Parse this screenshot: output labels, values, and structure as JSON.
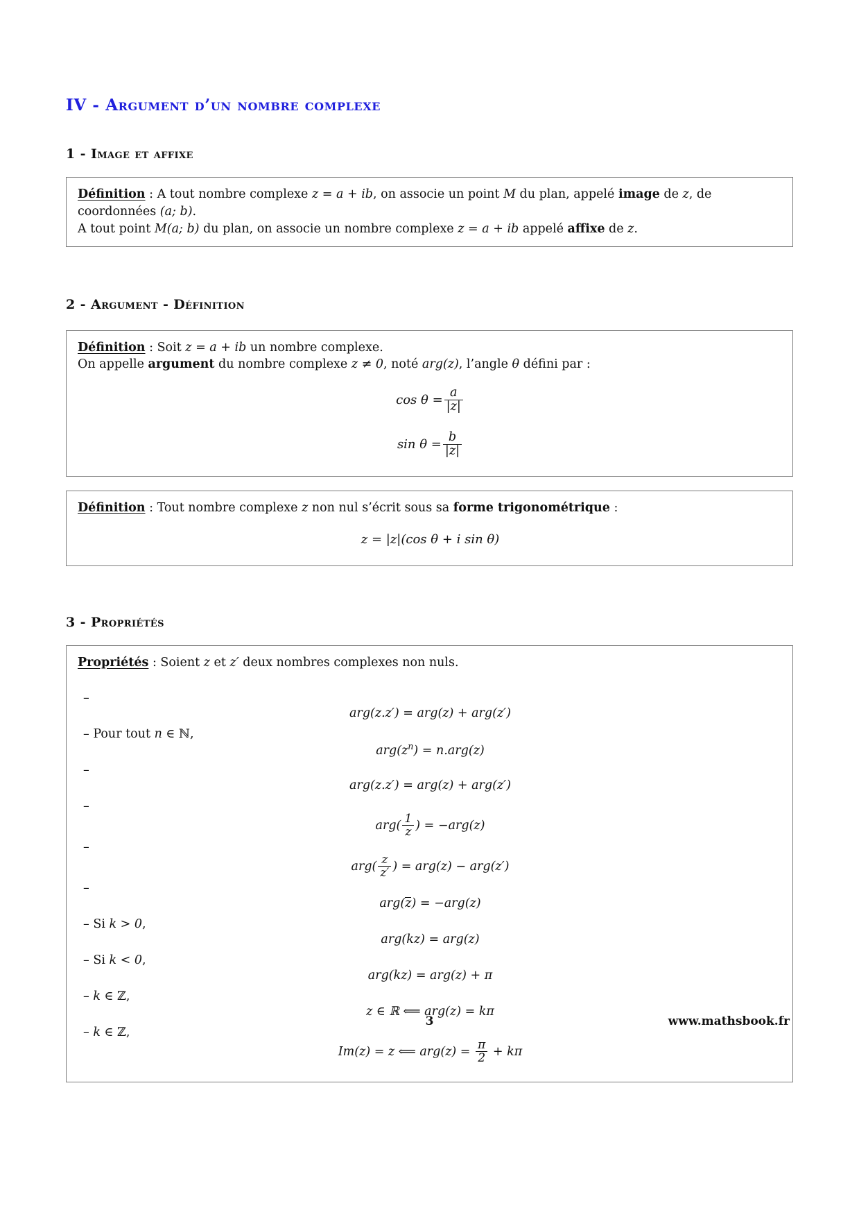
{
  "document": {
    "section": {
      "numeral": "IV",
      "separator": " - ",
      "title": "Argument d’un nombre complexe",
      "color": "#2020dd"
    },
    "subsections": [
      {
        "numeral": "1",
        "separator": " - ",
        "title": "Image et affixe"
      },
      {
        "numeral": "2",
        "separator": " - ",
        "title": "Argument - Définition"
      },
      {
        "numeral": "3",
        "separator": " - ",
        "title": "Propriétés"
      }
    ],
    "definition_1": {
      "label": "Définition",
      "line1_a": " : A tout nombre complexe ",
      "line1_z": "z = a + ib",
      "line1_b": ", on associe un point ",
      "line1_m": "M",
      "line1_c": " du plan, appelé ",
      "line1_bold": "image",
      "line1_d": " de ",
      "line1_zz": "z",
      "line1_e": ", de coordonnées ",
      "line1_coords": "(a; b)",
      "line1_f": ".",
      "line2_a": "A tout point ",
      "line2_m": "M(a; b)",
      "line2_b": " du plan, on associe un nombre complexe ",
      "line2_z": "z = a + ib",
      "line2_c": " appelé ",
      "line2_bold": "affixe",
      "line2_d": " de ",
      "line2_zz": "z",
      "line2_e": "."
    },
    "definition_2": {
      "label": "Définition",
      "line1_a": " : Soit ",
      "line1_z": "z = a + ib",
      "line1_b": " un nombre complexe.",
      "line2_a": "On appelle ",
      "line2_bold": "argument",
      "line2_b": " du nombre complexe ",
      "line2_z": "z ≠ 0",
      "line2_c": ", noté ",
      "line2_arg": "arg(z)",
      "line2_d": ", l’angle ",
      "line2_theta": "θ",
      "line2_e": " défini par :",
      "formula_cos_lhs": "cos θ =",
      "formula_cos_num": "a",
      "formula_cos_den": "|z|",
      "formula_sin_lhs": "sin θ =",
      "formula_sin_num": "b",
      "formula_sin_den": "|z|"
    },
    "definition_3": {
      "label": "Définition",
      "line1_a": " : Tout nombre complexe ",
      "line1_z": "z",
      "line1_b": " non nul s’écrit sous sa ",
      "line1_bold": "forme trigonométrique",
      "line1_c": " :",
      "formula": "z = |z|(cos θ + i sin θ)"
    },
    "properties": {
      "label": "Propriétés",
      "intro_a": " : Soient ",
      "intro_z": "z",
      "intro_b": " et ",
      "intro_zp": "z′",
      "intro_c": " deux nombres complexes non nuls.",
      "items": [
        {
          "dash": "–",
          "condition": "",
          "formula": "arg(z.z′) = arg(z) + arg(z′)"
        },
        {
          "dash": "–",
          "condition": "Pour tout n ∈ ℕ,",
          "formula": "arg(zⁿ) = n.arg(z)"
        },
        {
          "dash": "–",
          "condition": "",
          "formula": "arg(z.z′) = arg(z) + arg(z′)"
        },
        {
          "dash": "–",
          "condition": "",
          "formula": "arg(1/z) = −arg(z)"
        },
        {
          "dash": "–",
          "condition": "",
          "formula": "arg(z/z′) = arg(z) − arg(z′)"
        },
        {
          "dash": "–",
          "condition": "",
          "formula": "arg(z̅) = −arg(z)"
        },
        {
          "dash": "–",
          "condition": "Si k > 0,",
          "formula": "arg(kz) = arg(z)"
        },
        {
          "dash": "–",
          "condition": "Si k < 0,",
          "formula": "arg(kz) = arg(z) + π"
        },
        {
          "dash": "–",
          "condition": "k ∈ ℤ,",
          "formula": "z ∈ ℝ ⟺ arg(z) = kπ"
        },
        {
          "dash": "–",
          "condition": "k ∈ ℤ,",
          "formula": "Im(z) = z ⟺ arg(z) = π/2 + kπ"
        }
      ]
    },
    "footer": {
      "page_number": "3",
      "website": "www.mathsbook.fr"
    }
  }
}
